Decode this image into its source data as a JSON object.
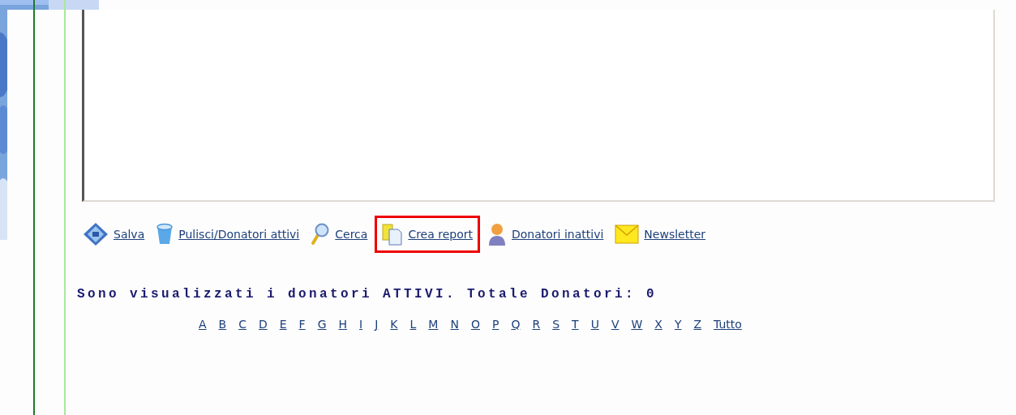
{
  "toolbar": [
    {
      "kind": "save",
      "label": "Salva",
      "highlighted": false
    },
    {
      "kind": "clear",
      "label": "Pulisci/Donatori attivi",
      "highlighted": false
    },
    {
      "kind": "search",
      "label": "Cerca",
      "highlighted": false
    },
    {
      "kind": "report",
      "label": "Crea report",
      "highlighted": true
    },
    {
      "kind": "person",
      "label": "Donatori inattivi",
      "highlighted": false
    },
    {
      "kind": "mail",
      "label": "Newsletter",
      "highlighted": false
    }
  ],
  "status": "Sono visualizzati i donatori ATTIVI. Totale Donatori: 0",
  "letters": [
    "A",
    "B",
    "C",
    "D",
    "E",
    "F",
    "G",
    "H",
    "I",
    "J",
    "K",
    "L",
    "M",
    "N",
    "O",
    "P",
    "Q",
    "R",
    "S",
    "T",
    "U",
    "V",
    "W",
    "X",
    "Y",
    "Z",
    "Tutto"
  ]
}
